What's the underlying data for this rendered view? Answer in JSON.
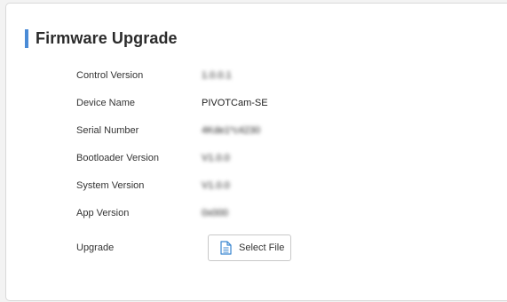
{
  "page": {
    "title": "Firmware Upgrade"
  },
  "fields": {
    "control_version": {
      "label": "Control Version",
      "value": "1.0.0.1"
    },
    "device_name": {
      "label": "Device Name",
      "value": "PIVOTCam-SE"
    },
    "serial_number": {
      "label": "Serial Number",
      "value": "4Kde1*c4230"
    },
    "bootloader_version": {
      "label": "Bootloader Version",
      "value": "V1.0.0"
    },
    "system_version": {
      "label": "System Version",
      "value": "V1.0.0"
    },
    "app_version": {
      "label": "App Version",
      "value": "0x000"
    },
    "upgrade": {
      "label": "Upgrade",
      "button_label": "Select File"
    }
  },
  "icons": {
    "file": "file-icon"
  },
  "colors": {
    "accent": "#4a8bd6",
    "icon": "#3a86d0"
  }
}
